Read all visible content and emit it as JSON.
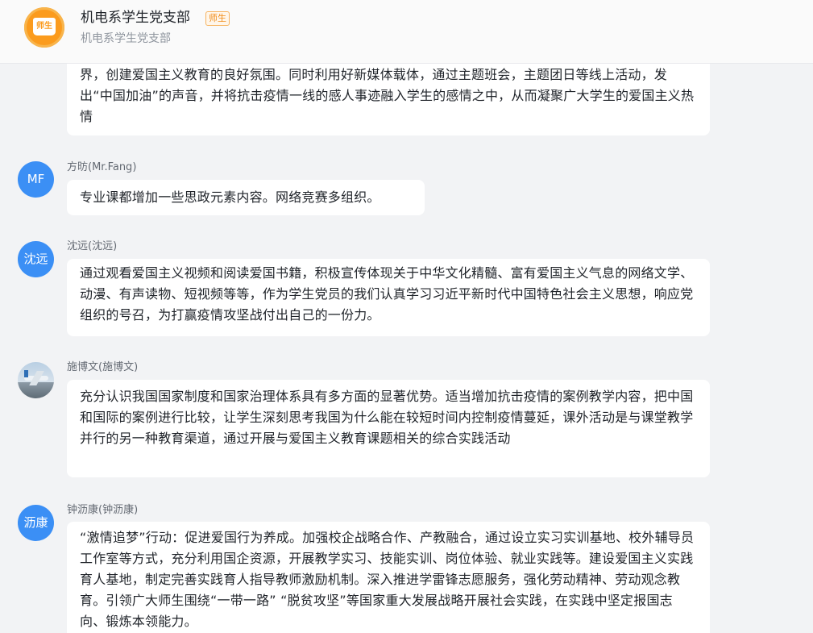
{
  "header": {
    "avatar_text": "师生",
    "title": "机电系学生党支部",
    "tag": "师生",
    "subtitle": "机电系学生党支部"
  },
  "messages": [
    {
      "text": "界，创建爱国主义教育的良好氛围。同时利用好新媒体载体，通过主题班会，主题团日等线上活动，发出“中国加油”的声音，并将抗击疫情一线的感人事迹融入学生的感情之中，从而凝聚广大学生的爱国主义热情"
    },
    {
      "avatar": "MF",
      "sender": "方昉(Mr.Fang)",
      "text": "专业课都增加一些思政元素内容。网络竞赛多组织。"
    },
    {
      "avatar": "沈远",
      "sender": "沈远(沈远)",
      "text": "通过观看爱国主义视频和阅读爱国书籍，积极宣传体现关于中华文化精髓、富有爱国主义气息的网络文学、动漫、有声读物、短视频等等，作为学生党员的我们认真学习习近平新时代中国特色社会主义思想，响应党组织的号召，为打赢疫情攻坚战付出自己的一份力。"
    },
    {
      "avatar_icon": "airplane-photo",
      "sender": "施博文(施博文)",
      "text": "充分认识我国国家制度和国家治理体系具有多方面的显著优势。适当增加抗击疫情的案例教学内容，把中国和国际的案例进行比较，让学生深刻思考我国为什么能在较短时间内控制疫情蔓延，课外活动是与课堂教学并行的另一种教育渠道，通过开展与爱国主义教育课题相关的综合实践活动"
    },
    {
      "avatar": "沥康",
      "sender": "钟沥康(钟沥康)",
      "text": "“激情追梦”行动：促进爱国行为养成。加强校企战略合作、产教融合，通过设立实习实训基地、校外辅导员工作室等方式，充分利用国企资源，开展教学实习、技能实训、岗位体验、就业实践等。建设爱国主义实践育人基地，制定完善实践育人指导教师激励机制。深入推进学雷锋志愿服务，强化劳动精神、劳动观念教育。引领广大师生围绕“一带一路” “脱贫攻坚”等国家重大发展战略开展社会实践，在实践中坚定报国志向、锻炼本领能力。"
    }
  ],
  "colors": {
    "background": "#f2f3f5",
    "bubble": "#ffffff",
    "avatar_blue": "#3b8ff5",
    "group_avatar": "#fb9b1d",
    "tag": "#f08c1a"
  }
}
